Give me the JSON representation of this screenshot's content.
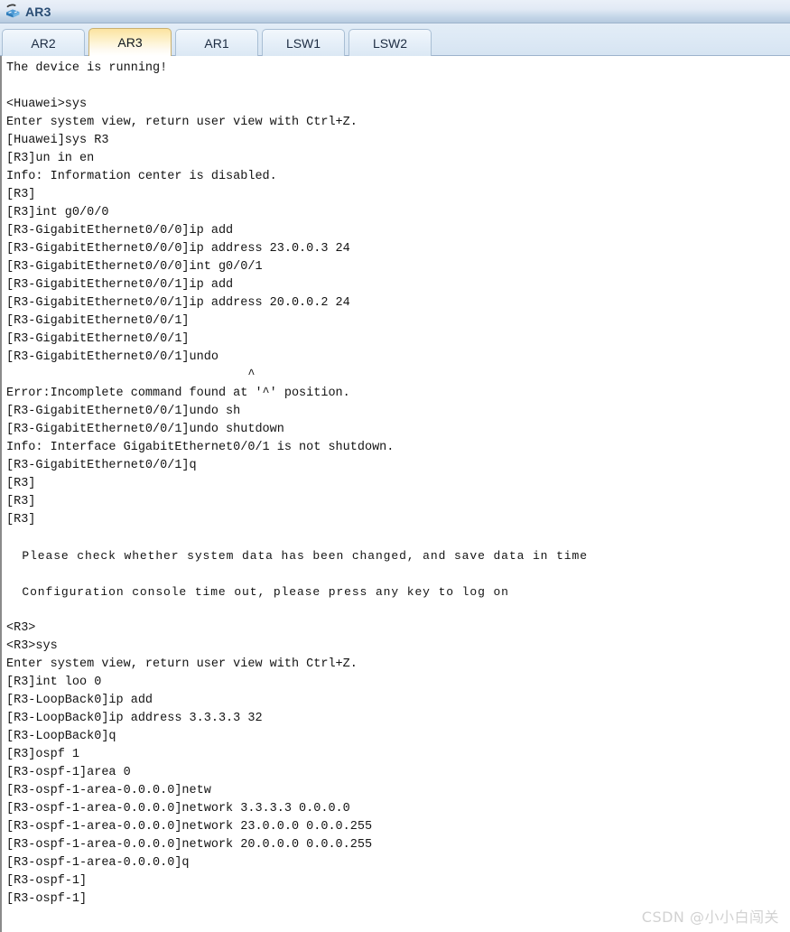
{
  "window": {
    "title": "AR3",
    "icon": "router-icon"
  },
  "tabs": [
    {
      "label": "AR2",
      "active": false
    },
    {
      "label": "AR3",
      "active": true
    },
    {
      "label": "AR1",
      "active": false
    },
    {
      "label": "LSW1",
      "active": false
    },
    {
      "label": "LSW2",
      "active": false
    }
  ],
  "terminal": {
    "lines": [
      {
        "text": "The device is running!",
        "style": "normal"
      },
      {
        "text": "",
        "style": "blank"
      },
      {
        "text": "<Huawei>sys",
        "style": "normal"
      },
      {
        "text": "Enter system view, return user view with Ctrl+Z.",
        "style": "normal"
      },
      {
        "text": "[Huawei]sys R3",
        "style": "normal"
      },
      {
        "text": "[R3]un in en",
        "style": "normal"
      },
      {
        "text": "Info: Information center is disabled.",
        "style": "normal"
      },
      {
        "text": "[R3]",
        "style": "normal"
      },
      {
        "text": "[R3]int g0/0/0",
        "style": "normal"
      },
      {
        "text": "[R3-GigabitEthernet0/0/0]ip add",
        "style": "normal"
      },
      {
        "text": "[R3-GigabitEthernet0/0/0]ip address 23.0.0.3 24",
        "style": "normal"
      },
      {
        "text": "[R3-GigabitEthernet0/0/0]int g0/0/1",
        "style": "normal"
      },
      {
        "text": "[R3-GigabitEthernet0/0/1]ip add",
        "style": "normal"
      },
      {
        "text": "[R3-GigabitEthernet0/0/1]ip address 20.0.0.2 24",
        "style": "normal"
      },
      {
        "text": "[R3-GigabitEthernet0/0/1]",
        "style": "normal"
      },
      {
        "text": "[R3-GigabitEthernet0/0/1]",
        "style": "normal"
      },
      {
        "text": "[R3-GigabitEthernet0/0/1]undo",
        "style": "normal"
      },
      {
        "text": "                                 ^",
        "style": "normal"
      },
      {
        "text": "Error:Incomplete command found at '^' position.",
        "style": "normal"
      },
      {
        "text": "[R3-GigabitEthernet0/0/1]undo sh",
        "style": "normal"
      },
      {
        "text": "[R3-GigabitEthernet0/0/1]undo shutdown",
        "style": "normal"
      },
      {
        "text": "Info: Interface GigabitEthernet0/0/1 is not shutdown.",
        "style": "normal"
      },
      {
        "text": "[R3-GigabitEthernet0/0/1]q",
        "style": "normal"
      },
      {
        "text": "[R3]",
        "style": "normal"
      },
      {
        "text": "[R3]",
        "style": "normal"
      },
      {
        "text": "[R3]",
        "style": "normal"
      },
      {
        "text": "",
        "style": "blank"
      },
      {
        "text": "  Please check whether system data has been changed, and save data in time",
        "style": "wide"
      },
      {
        "text": "",
        "style": "blank"
      },
      {
        "text": "  Configuration console time out, please press any key to log on",
        "style": "wide"
      },
      {
        "text": "",
        "style": "blank"
      },
      {
        "text": "<R3>",
        "style": "normal"
      },
      {
        "text": "<R3>sys",
        "style": "normal"
      },
      {
        "text": "Enter system view, return user view with Ctrl+Z.",
        "style": "normal"
      },
      {
        "text": "[R3]int loo 0",
        "style": "normal"
      },
      {
        "text": "[R3-LoopBack0]ip add",
        "style": "normal"
      },
      {
        "text": "[R3-LoopBack0]ip address 3.3.3.3 32",
        "style": "normal"
      },
      {
        "text": "[R3-LoopBack0]q",
        "style": "normal"
      },
      {
        "text": "[R3]ospf 1",
        "style": "normal"
      },
      {
        "text": "[R3-ospf-1]area 0",
        "style": "normal"
      },
      {
        "text": "[R3-ospf-1-area-0.0.0.0]netw",
        "style": "normal"
      },
      {
        "text": "[R3-ospf-1-area-0.0.0.0]network 3.3.3.3 0.0.0.0",
        "style": "normal"
      },
      {
        "text": "[R3-ospf-1-area-0.0.0.0]network 23.0.0.0 0.0.0.255",
        "style": "normal"
      },
      {
        "text": "[R3-ospf-1-area-0.0.0.0]network 20.0.0.0 0.0.0.255",
        "style": "normal"
      },
      {
        "text": "[R3-ospf-1-area-0.0.0.0]q",
        "style": "normal"
      },
      {
        "text": "[R3-ospf-1]",
        "style": "normal"
      },
      {
        "text": "[R3-ospf-1]",
        "style": "normal"
      }
    ]
  },
  "watermark": {
    "text": "CSDN @小小白闯关"
  },
  "colors": {
    "titlebar_top": "#eaf0f8",
    "titlebar_bottom": "#b5c9de",
    "title_text": "#2a4d74",
    "tab_active_top": "#fbe3a0",
    "tab_active_bottom": "#ffffff",
    "tabstrip_bg": "#dde9f5",
    "terminal_bg": "#ffffff",
    "terminal_text": "#131313",
    "watermark": "#d2d2d2"
  }
}
